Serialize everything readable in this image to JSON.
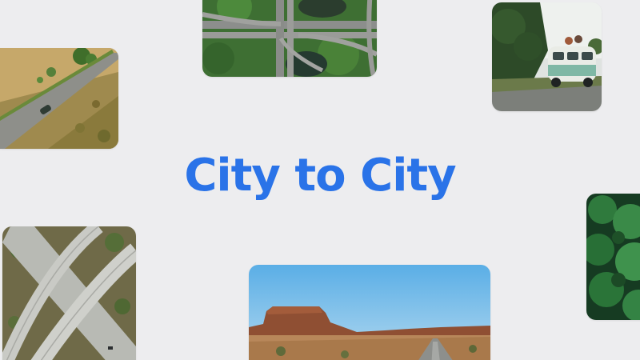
{
  "colors": {
    "background": "#ededef",
    "title": "#2a73e8"
  },
  "title": "City to City",
  "photos": [
    {
      "name": "countryside-road-photo"
    },
    {
      "name": "highway-interchange-photo"
    },
    {
      "name": "vintage-van-photo"
    },
    {
      "name": "forest-canopy-photo"
    },
    {
      "name": "overpass-photo"
    },
    {
      "name": "desert-road-photo"
    }
  ]
}
